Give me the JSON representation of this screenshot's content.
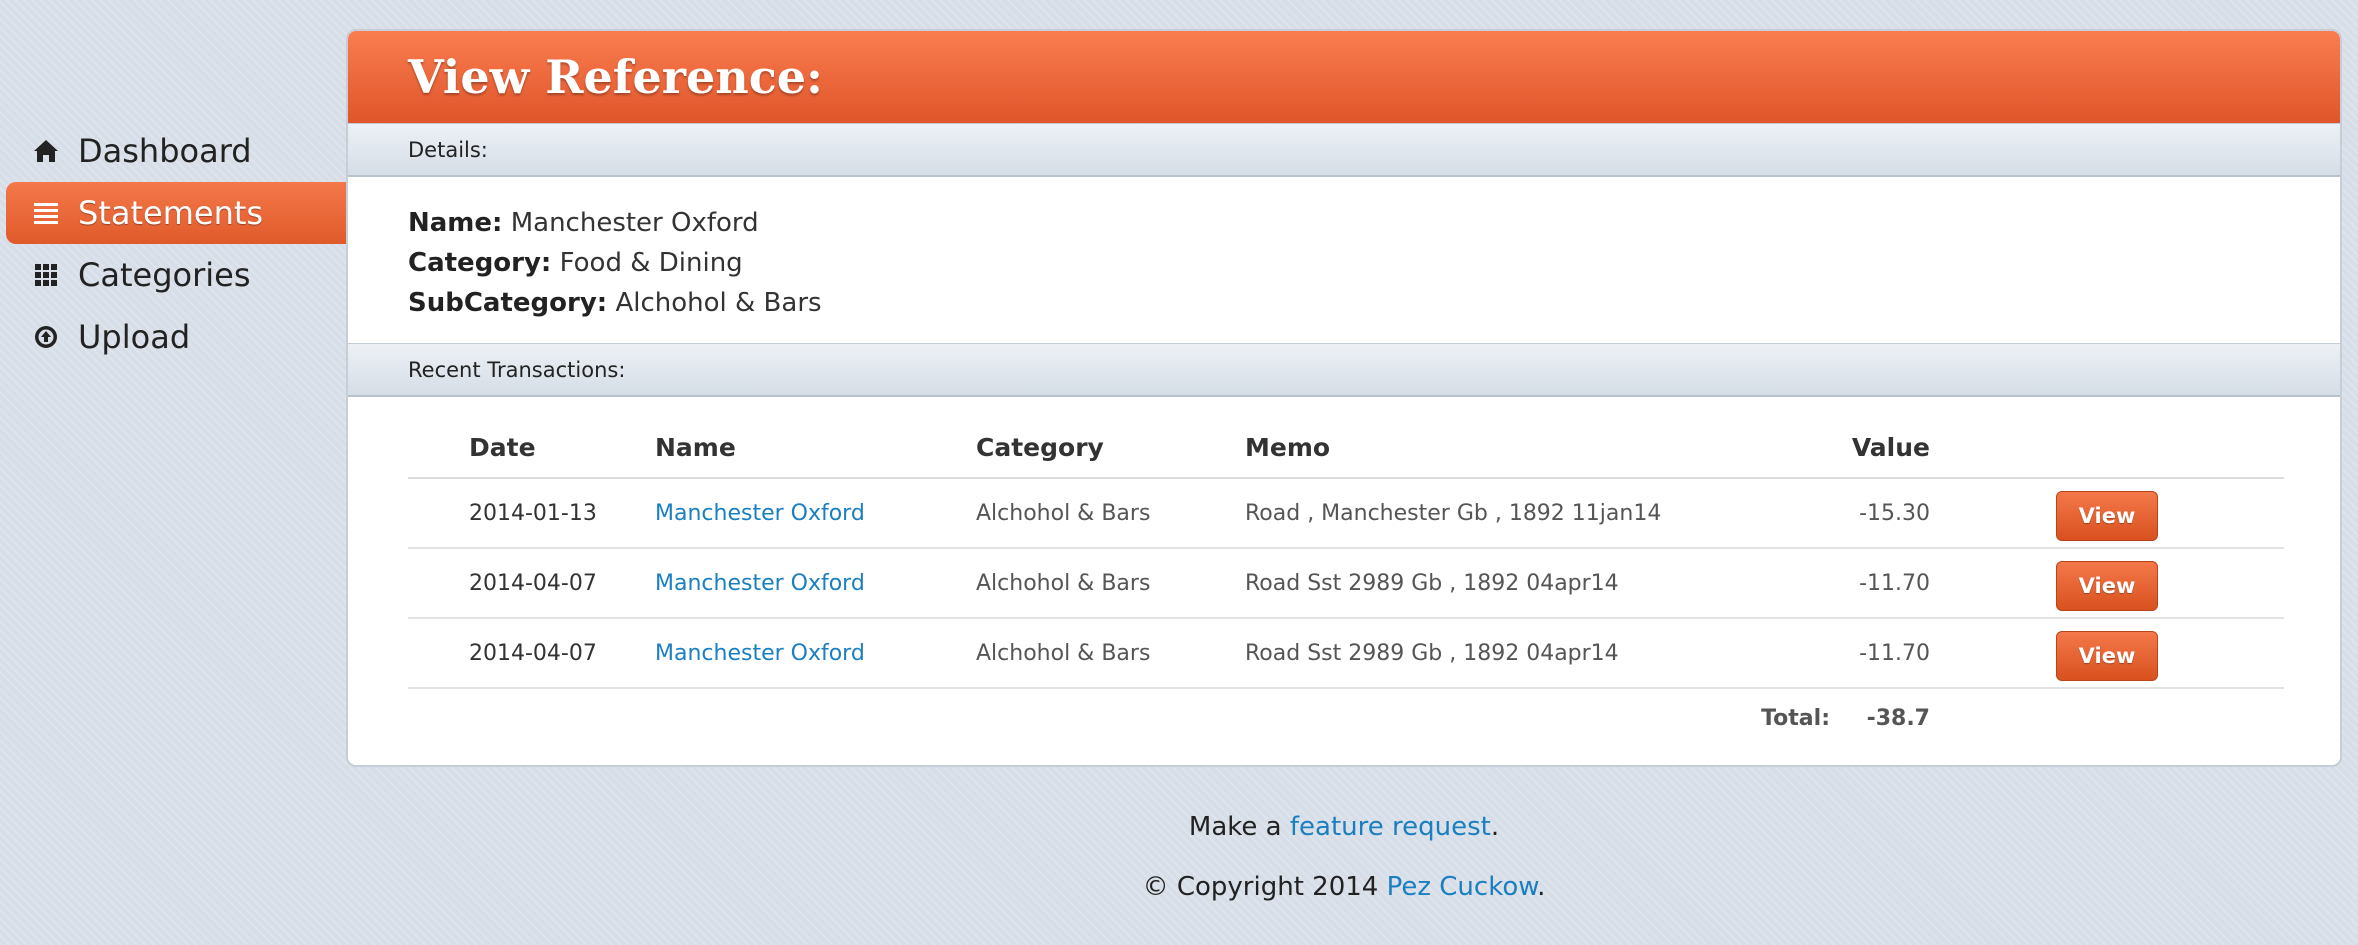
{
  "sidebar": {
    "items": [
      {
        "label": "Dashboard",
        "icon": "home-icon",
        "active": false
      },
      {
        "label": "Statements",
        "icon": "list-icon",
        "active": true
      },
      {
        "label": "Categories",
        "icon": "grid-icon",
        "active": false
      },
      {
        "label": "Upload",
        "icon": "upload-icon",
        "active": false
      }
    ]
  },
  "panel": {
    "title": "View Reference:",
    "details_heading": "Details:",
    "details": {
      "name_label": "Name:",
      "name_value": "Manchester Oxford",
      "category_label": "Category:",
      "category_value": "Food & Dining",
      "subcategory_label": "SubCategory:",
      "subcategory_value": "Alchohol & Bars"
    },
    "transactions_heading": "Recent Transactions:",
    "table": {
      "headers": {
        "date": "Date",
        "name": "Name",
        "category": "Category",
        "memo": "Memo",
        "value": "Value"
      },
      "rows": [
        {
          "date": "2014-01-13",
          "name": "Manchester Oxford",
          "category": "Alchohol & Bars",
          "memo": "Road , Manchester Gb , 1892 11jan14",
          "value": "-15.30",
          "action": "View"
        },
        {
          "date": "2014-04-07",
          "name": "Manchester Oxford",
          "category": "Alchohol & Bars",
          "memo": "Road Sst 2989 Gb , 1892 04apr14",
          "value": "-11.70",
          "action": "View"
        },
        {
          "date": "2014-04-07",
          "name": "Manchester Oxford",
          "category": "Alchohol & Bars",
          "memo": "Road Sst 2989 Gb , 1892 04apr14",
          "value": "-11.70",
          "action": "View"
        }
      ],
      "total_label": "Total:",
      "total_value": "-38.7"
    }
  },
  "footer": {
    "line1_prefix": "Make a ",
    "line1_link": "feature request",
    "line1_suffix": ".",
    "line2_prefix": "© Copyright 2014 ",
    "line2_link": "Pez Cuckow",
    "line2_suffix": "."
  },
  "colors": {
    "accent": "#e8602f",
    "link": "#1a7fc1",
    "background": "#d7dee8"
  }
}
